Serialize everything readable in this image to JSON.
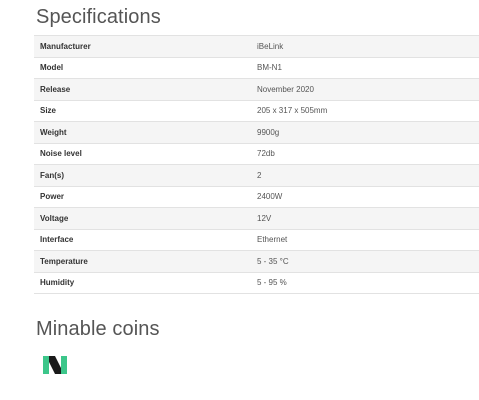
{
  "specifications": {
    "title": "Specifications",
    "rows": [
      {
        "label": "Manufacturer",
        "value": "iBeLink"
      },
      {
        "label": "Model",
        "value": "BM-N1"
      },
      {
        "label": "Release",
        "value": "November 2020"
      },
      {
        "label": "Size",
        "value": "205 x 317 x 505mm"
      },
      {
        "label": "Weight",
        "value": "9900g"
      },
      {
        "label": "Noise level",
        "value": "72db"
      },
      {
        "label": "Fan(s)",
        "value": "2"
      },
      {
        "label": "Power",
        "value": "2400W"
      },
      {
        "label": "Voltage",
        "value": "12V"
      },
      {
        "label": "Interface",
        "value": "Ethernet"
      },
      {
        "label": "Temperature",
        "value": "5 - 35 °C"
      },
      {
        "label": "Humidity",
        "value": "5 - 95 %"
      }
    ]
  },
  "minable_coins": {
    "title": "Minable coins",
    "coins": [
      {
        "icon": "nervos-coin-icon",
        "colors": [
          "#3cc68a",
          "#1b1b1b"
        ]
      }
    ]
  }
}
